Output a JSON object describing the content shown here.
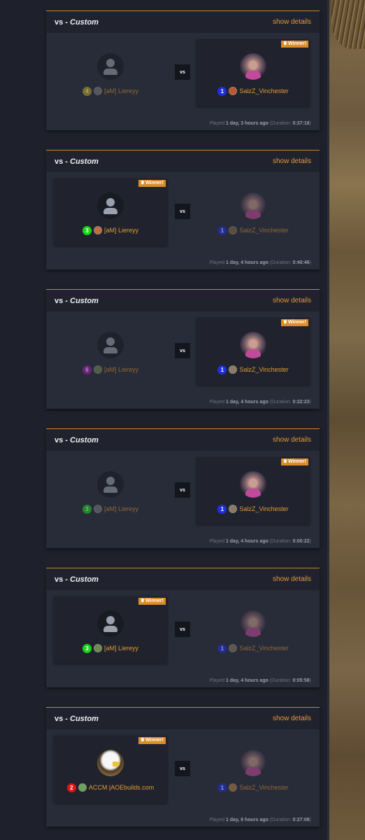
{
  "matches": [
    {
      "title_prefix": "vs - ",
      "title_mode": "Custom",
      "show_details": "show details",
      "winner_label": "Winner!",
      "winner_side": "right",
      "vs": "vs",
      "left": {
        "color_num": "4",
        "color": "#b4a81e",
        "civ_color": "#7b7b7b",
        "name": "[aM] Liereyy",
        "avatar": "default"
      },
      "right": {
        "color_num": "1",
        "color": "#1f2ee0",
        "civ_color": "#c8512a",
        "name": "SalzZ_Vinchester",
        "avatar": "photo"
      },
      "played_prefix": "Played ",
      "played_when": "1 day, 3 hours ago",
      "duration_prefix": " (Duration: ",
      "duration": "0:37:18",
      "duration_suffix": ")"
    },
    {
      "title_prefix": "vs - ",
      "title_mode": "Custom",
      "show_details": "show details",
      "winner_label": "Winner!",
      "winner_side": "left",
      "vs": "vs",
      "left": {
        "color_num": "3",
        "color": "#19d41a",
        "civ_color": "#c76a3a",
        "name": "[aM] Liereyy",
        "avatar": "default"
      },
      "right": {
        "color_num": "1",
        "color": "#1f2ee0",
        "civ_color": "#8a6a3a",
        "name": "SalzZ_Vinchester",
        "avatar": "photo"
      },
      "played_prefix": "Played ",
      "played_when": "1 day, 4 hours ago",
      "duration_prefix": " (Duration: ",
      "duration": "0:40:46",
      "duration_suffix": ")"
    },
    {
      "title_prefix": "vs - ",
      "title_mode": "Custom",
      "show_details": "show details",
      "winner_label": "Winner!",
      "winner_side": "right",
      "vs": "vs",
      "left": {
        "color_num": "6",
        "color": "#a51bb0",
        "civ_color": "#6f8a4c",
        "name": "[aM] Liereyy",
        "avatar": "default"
      },
      "right": {
        "color_num": "1",
        "color": "#1f2ee0",
        "civ_color": "#8a7a66",
        "name": "SalzZ_Vinchester",
        "avatar": "photo"
      },
      "played_prefix": "Played ",
      "played_when": "1 day, 4 hours ago",
      "duration_prefix": " (Duration: ",
      "duration": "0:22:23",
      "duration_suffix": ")"
    },
    {
      "title_prefix": "vs - ",
      "title_mode": "Custom",
      "show_details": "show details",
      "winner_label": "Winner!",
      "winner_side": "right",
      "vs": "vs",
      "left": {
        "color_num": "3",
        "color": "#19d41a",
        "civ_color": "#7b7b7b",
        "name": "[aM] Liereyy",
        "avatar": "default"
      },
      "right": {
        "color_num": "1",
        "color": "#1f2ee0",
        "civ_color": "#8a7a66",
        "name": "SalzZ_Vinchester",
        "avatar": "photo"
      },
      "played_prefix": "Played ",
      "played_when": "1 day, 4 hours ago",
      "duration_prefix": " (Duration: ",
      "duration": "0:00:22",
      "duration_suffix": ")"
    },
    {
      "title_prefix": "vs - ",
      "title_mode": "Custom",
      "show_details": "show details",
      "winner_label": "Winner!",
      "winner_side": "left",
      "vs": "vs",
      "left": {
        "color_num": "3",
        "color": "#19d41a",
        "civ_color": "#6f8a4c",
        "name": "[aM] Liereyy",
        "avatar": "default"
      },
      "right": {
        "color_num": "1",
        "color": "#1f2ee0",
        "civ_color": "#8a7a66",
        "name": "SalzZ_Vinchester",
        "avatar": "photo"
      },
      "played_prefix": "Played ",
      "played_when": "1 day, 4 hours ago",
      "duration_prefix": " (Duration: ",
      "duration": "0:05:58",
      "duration_suffix": ")"
    },
    {
      "title_prefix": "vs - ",
      "title_mode": "Custom",
      "show_details": "show details",
      "winner_label": "Winner!",
      "winner_side": "left",
      "vs": "vs",
      "left": {
        "color_num": "2",
        "color": "#e01515",
        "civ_color": "#6aa35a",
        "name": "ACCM |AOEbuilds.com",
        "avatar": "eagle"
      },
      "right": {
        "color_num": "1",
        "color": "#1f2ee0",
        "civ_color": "#c0823a",
        "name": "SalzZ_Vinchester",
        "avatar": "photo"
      },
      "played_prefix": "Played ",
      "played_when": "1 day, 6 hours ago",
      "duration_prefix": " (Duration: ",
      "duration": "0:27:08",
      "duration_suffix": ")"
    }
  ]
}
